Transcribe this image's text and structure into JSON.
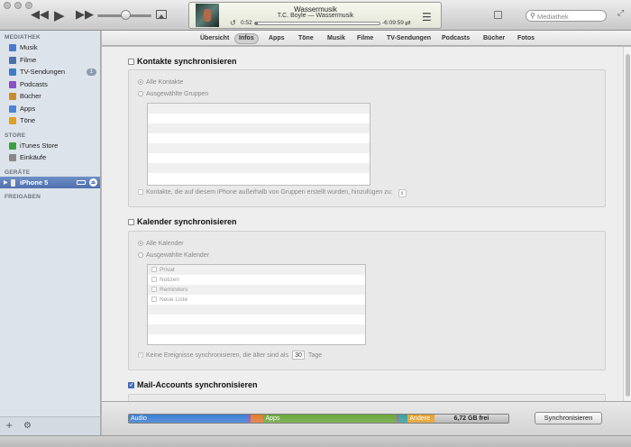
{
  "player": {
    "song": "Wassermusik",
    "artist": "T.C. Boyle — Wassermusik",
    "elapsed": "0:52",
    "remaining": "-6:09:59",
    "progress": 0.02,
    "search_placeholder": "Mediathek"
  },
  "sidebar": {
    "library_header": "MEDIATHEK",
    "library": [
      {
        "label": "Musik",
        "icon": "music-note-icon",
        "color": "#4a7bd0"
      },
      {
        "label": "Filme",
        "icon": "film-icon",
        "color": "#4a6fa8"
      },
      {
        "label": "TV-Sendungen",
        "icon": "tv-icon",
        "color": "#3f7cc4",
        "badge": "1"
      },
      {
        "label": "Podcasts",
        "icon": "podcast-icon",
        "color": "#8a4fc4"
      },
      {
        "label": "Bücher",
        "icon": "book-icon",
        "color": "#c98a2e"
      },
      {
        "label": "Apps",
        "icon": "apps-icon",
        "color": "#4f83d6"
      },
      {
        "label": "Töne",
        "icon": "bell-icon",
        "color": "#e0a020"
      }
    ],
    "store_header": "STORE",
    "store": [
      {
        "label": "iTunes Store",
        "icon": "store-icon",
        "color": "#3da040"
      },
      {
        "label": "Einkäufe",
        "icon": "purchases-icon",
        "color": "#888888"
      }
    ],
    "devices_header": "GERÄTE",
    "device": {
      "label": "iPhone 5"
    },
    "shared_header": "FREIGABEN"
  },
  "tabs": [
    "Übersicht",
    "Infos",
    "Apps",
    "Töne",
    "Musik",
    "Filme",
    "TV-Sendungen",
    "Podcasts",
    "Bücher",
    "Fotos"
  ],
  "active_tab": "Infos",
  "contacts": {
    "title": "Kontakte synchronisieren",
    "all": "Alle Kontakte",
    "selected": "Ausgewählte Gruppen",
    "add_option": "Kontakte, die auf diesem iPhone außerhalb von Gruppen erstellt wurden, hinzufügen zu:"
  },
  "calendar": {
    "title": "Kalender synchronisieren",
    "all": "Alle Kalender",
    "selected": "Ausgewählte Kalender",
    "items": [
      "Privat",
      "Notizen",
      "Reminders",
      "Neue Liste"
    ],
    "older_prefix": "Keine Ereignisse synchronisieren, die älter sind als",
    "days": "30",
    "older_suffix": "Tage"
  },
  "mail": {
    "title": "Mail-Accounts synchronisieren"
  },
  "capacity": {
    "audio": "Audio",
    "apps": "Apps",
    "other": "Andere",
    "free": "6,72 GB frei",
    "segments": [
      {
        "key": "audio",
        "fraction": 0.31,
        "color": "#3b7fd6"
      },
      {
        "key": "video",
        "fraction": 0.01,
        "color": "#8c5bc2"
      },
      {
        "key": "photos",
        "fraction": 0.035,
        "color": "#e07a2e"
      },
      {
        "key": "apps",
        "fraction": 0.35,
        "color": "#6aa83a"
      },
      {
        "key": "books",
        "fraction": 0.005,
        "color": "#b05aa8"
      },
      {
        "key": "other2",
        "fraction": 0.025,
        "color": "#3aa0a0"
      },
      {
        "key": "other",
        "fraction": 0.07,
        "color": "#e7a229"
      },
      {
        "key": "free",
        "fraction": 0.195,
        "color": "#c7c7c7"
      }
    ],
    "sync_button": "Synchronisieren"
  }
}
